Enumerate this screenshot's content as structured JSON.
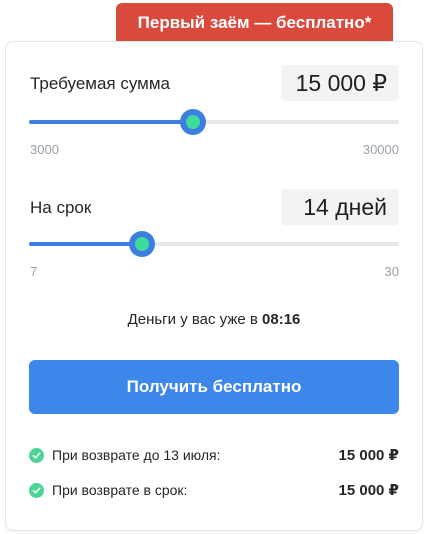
{
  "promo": {
    "label": "Первый заём — бесплатно*"
  },
  "amount": {
    "label": "Требуемая сумма",
    "value": "15 000 ₽",
    "min_label": "3000",
    "max_label": "30000",
    "min": 3000,
    "max": 30000,
    "current": 15000
  },
  "term": {
    "label": "На срок",
    "value": "14 дней",
    "min_label": "7",
    "max_label": "30",
    "min": 7,
    "max": 30,
    "current": 14
  },
  "eta": {
    "prefix": "Деньги у вас уже в ",
    "time": "08:16"
  },
  "cta": {
    "label": "Получить бесплатно"
  },
  "summary": [
    {
      "label": "При возврате до 13 июля:",
      "amount": "15 000 ₽"
    },
    {
      "label": "При возврате в срок:",
      "amount": "15 000 ₽"
    }
  ],
  "colors": {
    "accent": "#3d86ea",
    "promo": "#d94a3d",
    "thumb_inner": "#3ddc9a",
    "check": "#4cd495"
  }
}
